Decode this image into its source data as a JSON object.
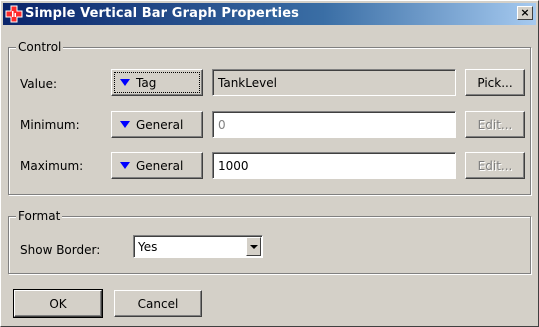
{
  "window": {
    "title": "Simple Vertical Bar Graph Properties",
    "close_label": "×",
    "accent": "#0a246a"
  },
  "control": {
    "legend": "Control",
    "value": {
      "label": "Value:",
      "type_button": "Tag",
      "field": "TankLevel",
      "action": "Pick..."
    },
    "minimum": {
      "label": "Minimum:",
      "type_button": "General",
      "field": "0",
      "action": "Edit..."
    },
    "maximum": {
      "label": "Maximum:",
      "type_button": "General",
      "field": "1000",
      "action": "Edit..."
    }
  },
  "format": {
    "legend": "Format",
    "show_border": {
      "label": "Show Border:",
      "value": "Yes"
    }
  },
  "buttons": {
    "ok": "OK",
    "cancel": "Cancel"
  },
  "icons": {
    "title_icon": "red-cross-bar-icon",
    "dropdown": "blue-triangle-down-icon"
  }
}
